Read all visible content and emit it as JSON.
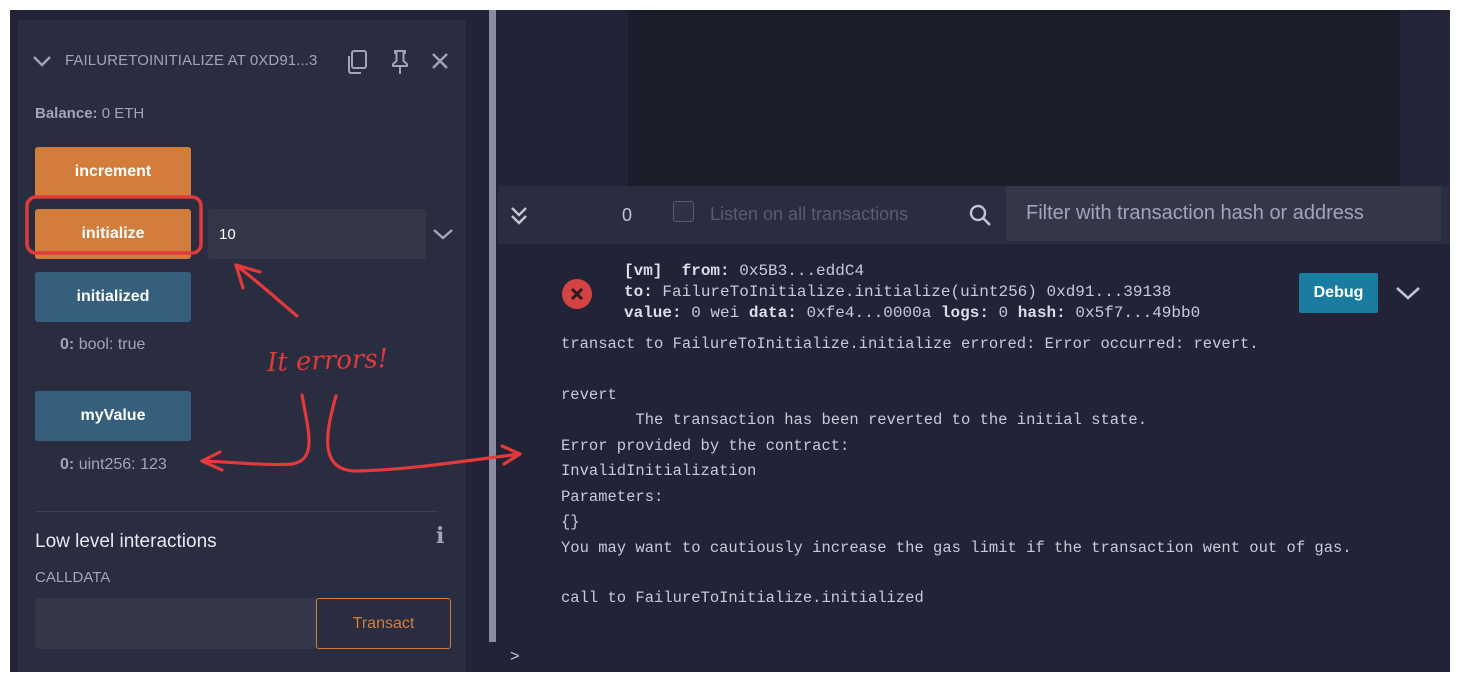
{
  "deployed_contract": {
    "title": "FAILURETOINITIALIZE AT 0XD91...3",
    "balance_label": "Balance:",
    "balance_value": "0 ETH",
    "functions": [
      {
        "label": "increment"
      },
      {
        "label": "initialize",
        "arg_value": "10"
      },
      {
        "label": "initialized",
        "result_index": "0:",
        "result_text": "bool: true"
      },
      {
        "label": "myValue",
        "result_index": "0:",
        "result_text": "uint256: 123"
      }
    ],
    "low_level": {
      "title": "Low level interactions",
      "info_glyph": "i",
      "calldata_label": "CALLDATA",
      "transact_label": "Transact"
    }
  },
  "terminal": {
    "tx_count": "0",
    "listen_label": "Listen on all transactions",
    "filter_placeholder": "Filter with transaction hash or address",
    "entry": {
      "vm": "[vm]",
      "from_key": "from:",
      "from_val": "0x5B3...eddC4",
      "to_key": "to:",
      "to_val": "FailureToInitialize.initialize(uint256) 0xd91...39138",
      "value_key": "value:",
      "value_val": "0 wei",
      "data_key": "data:",
      "data_val": "0xfe4...0000a",
      "logs_key": "logs:",
      "logs_val": "0",
      "hash_key": "hash:",
      "hash_val": "0x5f7...49bb0",
      "debug_label": "Debug"
    },
    "log_lines": [
      "transact to FailureToInitialize.initialize errored: Error occurred: revert.",
      "revert",
      "        The transaction has been reverted to the initial state.",
      "Error provided by the contract:",
      "InvalidInitialization",
      "Parameters:",
      "{}",
      "You may want to cautiously increase the gas limit if the transaction went out of gas.",
      "call to FailureToInitialize.initialized"
    ],
    "prompt": ">"
  },
  "annotation": {
    "text": "It errors!"
  },
  "colors": {
    "background": "#222336",
    "panel": "#2a2c3f",
    "accent_orange": "#d27d3b",
    "call_blue": "#355f7d",
    "debug_blue": "#1a7ca1",
    "error_red": "#d34343",
    "annotation_red": "#e03a3a"
  },
  "icons": {
    "collapse": "chevron-down-icon",
    "copy": "copy-icon",
    "pin": "pin-icon",
    "close": "close-icon",
    "expand_args": "chevron-down-icon",
    "terminal_toggle": "double-chevron-down-icon",
    "search": "search-icon",
    "error": "error-icon",
    "expand_tx": "chevron-down-icon"
  }
}
